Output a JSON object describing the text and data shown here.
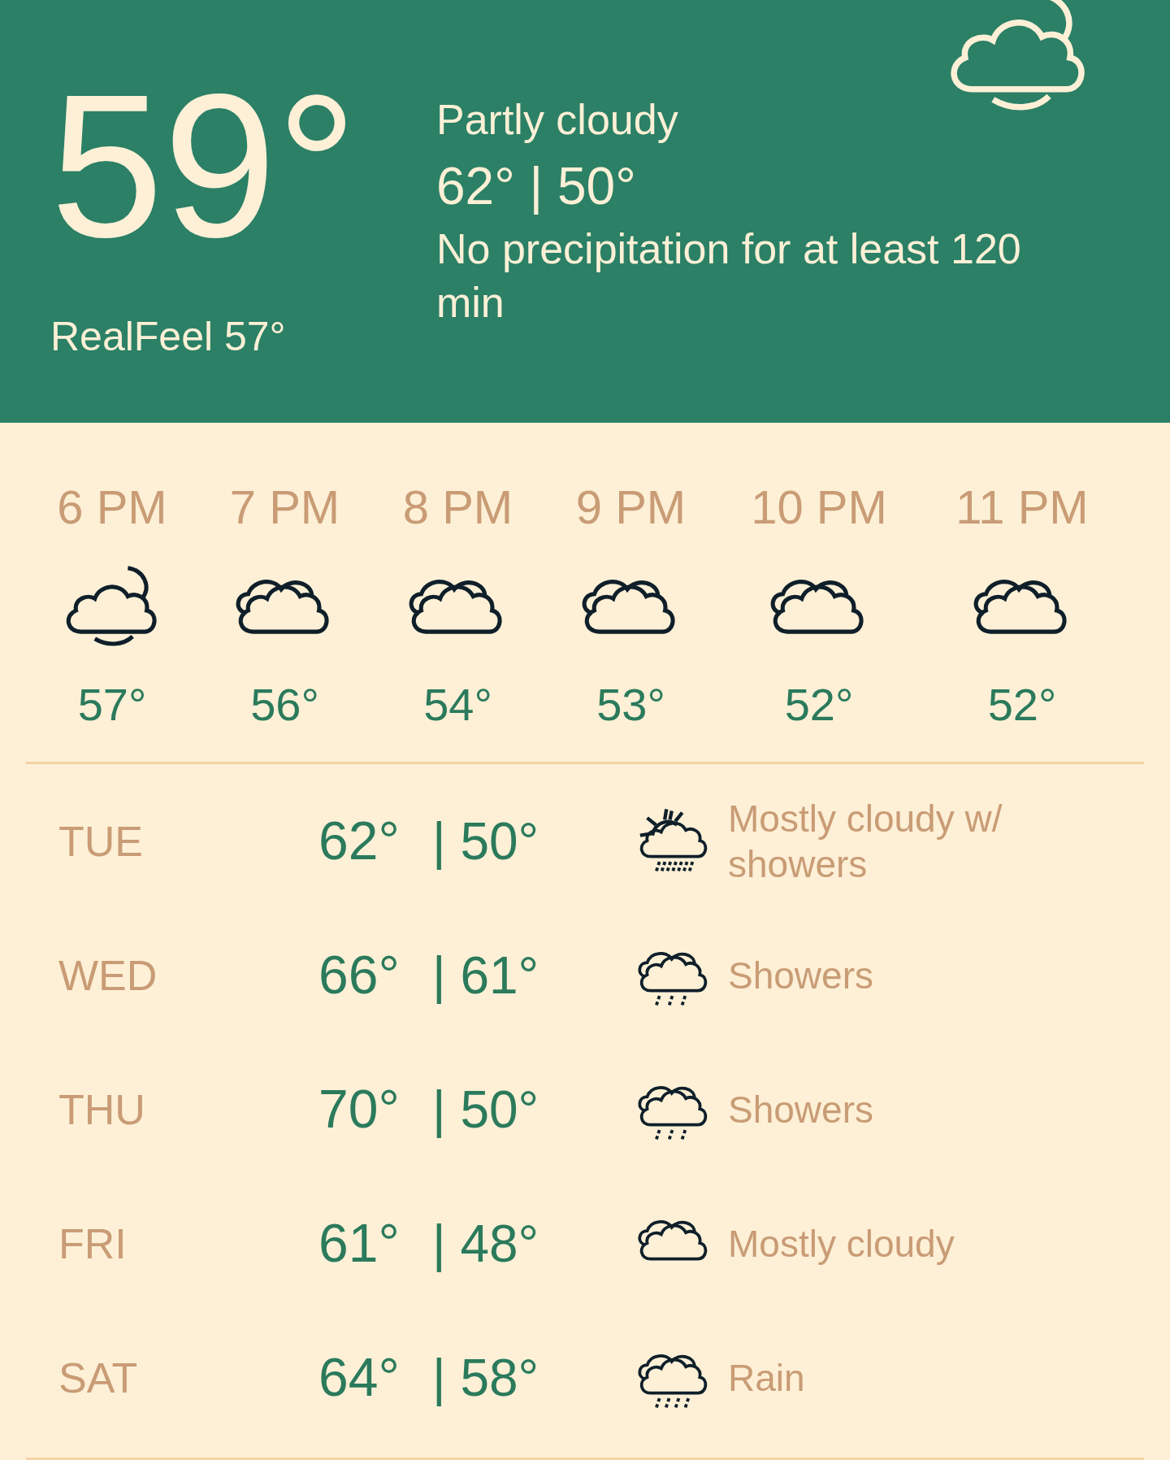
{
  "current": {
    "temperature": "59°",
    "condition": "Partly cloudy",
    "high_low": "62° | 50°",
    "precipitation": "No precipitation for at least 120 min",
    "realfeel": "RealFeel 57°",
    "kind": "night-partly-cloudy"
  },
  "hourly": [
    {
      "time": "6 PM",
      "kind": "night-partly-cloudy",
      "temperature": "57°"
    },
    {
      "time": "7 PM",
      "kind": "cloudy",
      "temperature": "56°"
    },
    {
      "time": "8 PM",
      "kind": "cloudy",
      "temperature": "54°"
    },
    {
      "time": "9 PM",
      "kind": "cloudy",
      "temperature": "53°"
    },
    {
      "time": "10 PM",
      "kind": "cloudy",
      "temperature": "52°"
    },
    {
      "time": "11 PM",
      "kind": "cloudy",
      "temperature": "52°"
    }
  ],
  "daily": [
    {
      "day": "TUE",
      "high": "62°",
      "low": "| 50°",
      "kind": "sun-showers",
      "condition": "Mostly cloudy w/ showers"
    },
    {
      "day": "WED",
      "high": "66°",
      "low": "| 61°",
      "kind": "showers",
      "condition": "Showers"
    },
    {
      "day": "THU",
      "high": "70°",
      "low": "| 50°",
      "kind": "showers",
      "condition": "Showers"
    },
    {
      "day": "FRI",
      "high": "61°",
      "low": "| 48°",
      "kind": "cloudy",
      "condition": "Mostly cloudy"
    },
    {
      "day": "SAT",
      "high": "64°",
      "low": "| 58°",
      "kind": "rain",
      "condition": "Rain"
    }
  ]
}
